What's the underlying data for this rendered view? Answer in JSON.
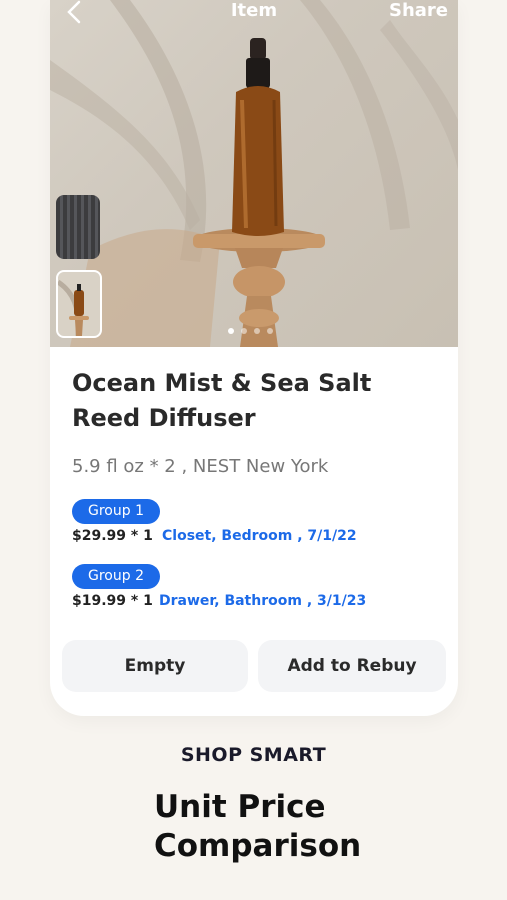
{
  "header": {
    "back_icon": "chevron-left-icon",
    "title": "Item",
    "share_label": "Share"
  },
  "gallery": {
    "thumbnail_count": 2,
    "dot_count": 4,
    "active_dot": 1
  },
  "product": {
    "name": "Ocean Mist & Sea Salt Reed Diffuser",
    "meta": "5.9 fl oz * 2 , NEST New York"
  },
  "groups": [
    {
      "label": "Group 1",
      "price": "$29.99 * 1",
      "location": "Closet, Bedroom , 7/1/22"
    },
    {
      "label": "Group 2",
      "price": "$19.99 * 1",
      "location": "Drawer, Bathroom , 3/1/23"
    }
  ],
  "actions": {
    "empty_label": "Empty",
    "rebuy_label": "Add to Rebuy"
  },
  "marketing": {
    "tagline": "SHOP SMART",
    "headline_line1": "Unit Price",
    "headline_line2": "Comparison"
  },
  "colors": {
    "accent": "#1c6ae8",
    "background": "#f7f4ef",
    "bottle": "#8a4a16"
  }
}
